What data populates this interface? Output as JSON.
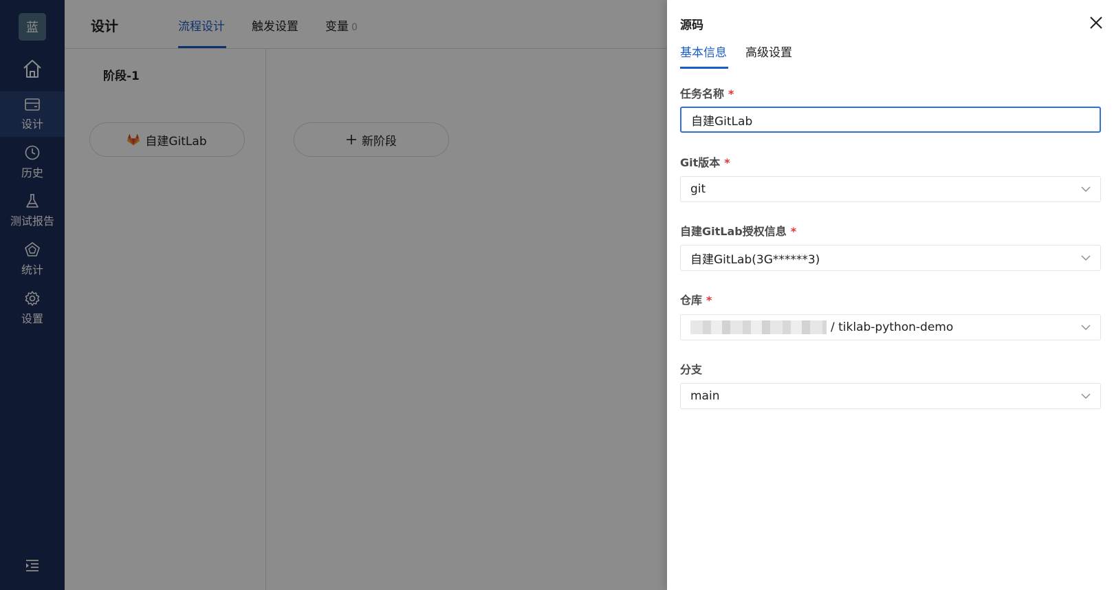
{
  "sidebar": {
    "logo_text": "蓝",
    "items": [
      {
        "label": "设计",
        "icon": "wallet-icon"
      },
      {
        "label": "历史",
        "icon": "clock-icon"
      },
      {
        "label": "测试报告",
        "icon": "flask-icon"
      },
      {
        "label": "统计",
        "icon": "pentagon-icon"
      },
      {
        "label": "设置",
        "icon": "gear-icon"
      }
    ],
    "active_index": 0
  },
  "header": {
    "title": "设计",
    "tabs": [
      {
        "label": "流程设计"
      },
      {
        "label": "触发设置"
      },
      {
        "label": "变量",
        "count": "0"
      }
    ],
    "active_tab": 0
  },
  "canvas": {
    "stage_title": "阶段-1",
    "task_label": "自建GitLab",
    "new_stage_label": "新阶段"
  },
  "drawer": {
    "title": "源码",
    "tabs": [
      {
        "label": "基本信息"
      },
      {
        "label": "高级设置"
      }
    ],
    "active_tab": 0,
    "fields": {
      "task_name": {
        "label": "任务名称",
        "value": "自建GitLab"
      },
      "git_version": {
        "label": "Git版本",
        "value": "git"
      },
      "auth": {
        "label": "自建GitLab授权信息",
        "value": "自建GitLab(3G******3)"
      },
      "repo": {
        "label": "仓库",
        "value": "/ tiklab-python-demo"
      },
      "branch": {
        "label": "分支",
        "value": "main"
      }
    }
  },
  "colors": {
    "sidebar_bg": "#1c305c",
    "accent": "#1a5cc8",
    "required": "#e03535"
  }
}
